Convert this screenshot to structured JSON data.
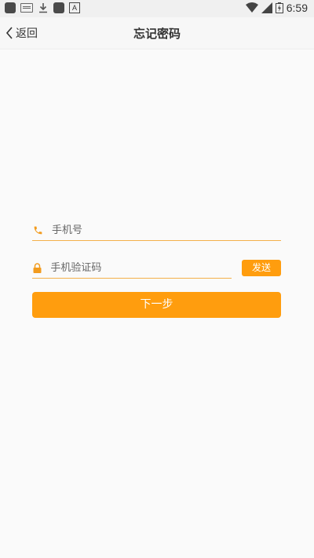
{
  "status_bar": {
    "time": "6:59",
    "left_icons": [
      "app-icon",
      "keyboard-icon",
      "download-icon",
      "app-icon",
      "a-icon"
    ],
    "right_icons": [
      "wifi-icon",
      "signal-icon",
      "battery-icon"
    ]
  },
  "nav": {
    "back_label": "返回",
    "title": "忘记密码"
  },
  "form": {
    "phone_placeholder": "手机号",
    "code_placeholder": "手机验证码",
    "send_label": "发送",
    "next_label": "下一步"
  },
  "colors": {
    "accent": "#ff9d0e",
    "underline": "#f4b04a",
    "background": "#fafafa"
  }
}
